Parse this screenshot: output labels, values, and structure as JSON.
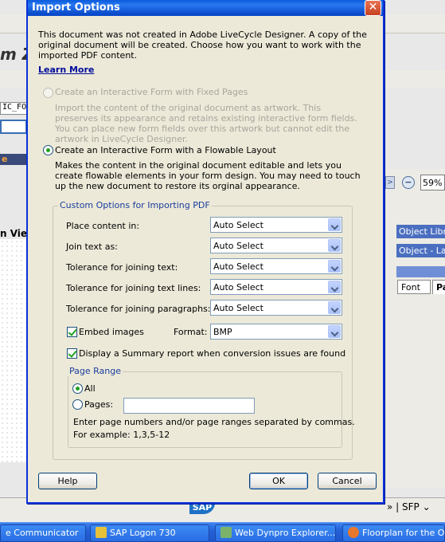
{
  "background": {
    "app_title_fragment": "m Z",
    "field_fragment": "IC_FO",
    "orange_label": "e",
    "view_label": "n Vie",
    "zoom": "59%",
    "zoom_minus": "−",
    "nav_arrow": ">",
    "object_library": "Object Library",
    "object_layout": "Object - Layout",
    "tab_font": "Font",
    "tab_pa": "Pa",
    "status_logo": "SAP",
    "status_right": "» | SFP ⌄"
  },
  "taskbar": {
    "items": [
      {
        "label": "e Communicator",
        "icon_color": "#5aa0e8"
      },
      {
        "label": "SAP Logon 730",
        "icon_color": "#e6c13a"
      },
      {
        "label": "Web Dynpro Explorer...",
        "icon_color": "#7bb36a"
      },
      {
        "label": "Floorplan for the Ove...",
        "icon_color": "#e8772e"
      }
    ]
  },
  "dialog": {
    "title": "Import Options",
    "close_glyph": "✕",
    "intro": "This document was not created in Adobe LiveCycle Designer. A copy of the original document will be created. Choose how you want to work with the imported PDF content.",
    "learn_more": "Learn More",
    "option_fixed": {
      "label": "Create an Interactive Form with Fixed Pages",
      "description": "Import the content of the original document as artwork. This preserves its appearance and retains existing interactive form fields. You can place new form fields over this artwork but cannot edit the artwork in LiveCycle Designer.",
      "selected": false,
      "enabled": false
    },
    "option_flowable": {
      "label": "Create an Interactive Form with a Flowable Layout",
      "description": "Makes the content in the original document editable and lets you create flowable elements in your form design. You may need to touch up the new document to restore its orginal appearance.",
      "selected": true,
      "enabled": true
    },
    "custom_options": {
      "legend": "Custom Options for Importing PDF",
      "fields": [
        {
          "label": "Place content in:",
          "value": "Auto Select"
        },
        {
          "label": "Join text as:",
          "value": "Auto Select"
        },
        {
          "label": "Tolerance for joining text:",
          "value": "Auto Select"
        },
        {
          "label": "Tolerance for joining text lines:",
          "value": "Auto Select"
        },
        {
          "label": "Tolerance for joining paragraphs:",
          "value": "Auto Select"
        }
      ],
      "embed_images": {
        "label": "Embed images",
        "checked": true
      },
      "format": {
        "label": "Format:",
        "value": "BMP"
      },
      "summary_report": {
        "label": "Display a Summary report when conversion issues are found",
        "checked": true
      }
    },
    "page_range": {
      "legend": "Page Range",
      "all_label": "All",
      "all_selected": true,
      "pages_label": "Pages:",
      "pages_value": "",
      "hint_line1": "Enter page numbers and/or page ranges separated by commas.",
      "hint_line2": "For example: 1,3,5-12"
    },
    "buttons": {
      "help": "Help",
      "ok": "OK",
      "cancel": "Cancel"
    }
  }
}
